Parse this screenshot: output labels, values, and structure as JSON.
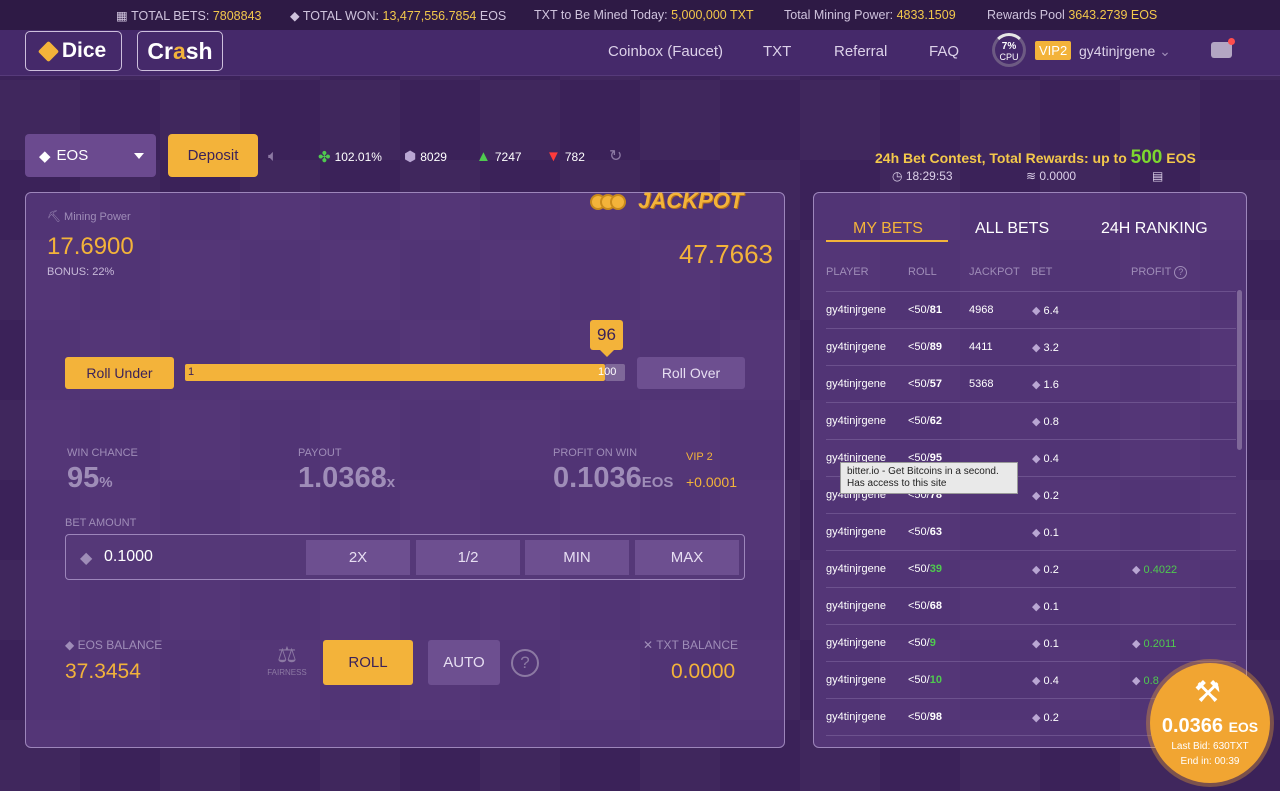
{
  "topbar": {
    "total_bets_label": "TOTAL BETS:",
    "total_bets": "7808843",
    "total_won_label": "TOTAL WON:",
    "total_won": "13,477,556.7854",
    "total_won_unit": "EOS",
    "txt_mined_label": "TXT to Be Mined Today:",
    "txt_mined": "5,000,000 TXT",
    "mining_power_label": "Total Mining Power:",
    "mining_power": "4833.1509",
    "rewards_label": "Rewards Pool",
    "rewards": "3643.2739 EOS"
  },
  "header": {
    "dice": "Dice",
    "crash_pre": "Cr",
    "crash_a": "a",
    "crash_post": "sh",
    "nav": [
      "Coinbox (Faucet)",
      "TXT",
      "Referral",
      "FAQ"
    ],
    "cpu_pct": "7%",
    "cpu_label": "CPU",
    "vip": "VIP2",
    "username": "gy4tinjrgene"
  },
  "controls": {
    "currency": "EOS",
    "deposit": "Deposit",
    "stats": [
      {
        "icon": "clover-icon",
        "value": "102.01%"
      },
      {
        "icon": "cube-icon",
        "value": "8029"
      },
      {
        "icon": "thumbs-up-icon",
        "value": "7247"
      },
      {
        "icon": "thumbs-down-icon",
        "value": "782"
      }
    ]
  },
  "contest": {
    "text": "24h Bet Contest, Total Rewards: up to",
    "amount": "500",
    "unit": "EOS",
    "timer": "18:29:53",
    "value": "0.0000"
  },
  "game": {
    "mining_power_label": "Mining Power",
    "mining_power": "17.6900",
    "bonus": "BONUS: 22%",
    "jackpot_label": "JACKPOT",
    "jackpot_value": "47.7663",
    "roll_under": "Roll Under",
    "roll_over": "Roll Over",
    "slider_min": "1",
    "slider_max": "100",
    "slider_value": "96",
    "win_chance_label": "WIN CHANCE",
    "win_chance": "95",
    "win_chance_unit": "%",
    "payout_label": "PAYOUT",
    "payout": "1.0368",
    "payout_unit": "x",
    "profit_label": "PROFIT ON WIN",
    "profit": "0.1036",
    "profit_unit": "EOS",
    "vip_label": "VIP 2",
    "vip_bonus": "+0.0001",
    "bet_amount_label": "BET AMOUNT",
    "bet_amount": "0.1000",
    "bet_buttons": [
      "2X",
      "1/2",
      "MIN",
      "MAX"
    ],
    "eos_balance_label": "EOS BALANCE",
    "eos_balance": "37.3454",
    "fairness": "FAIRNESS",
    "roll": "ROLL",
    "auto": "AUTO",
    "txt_balance_label": "TXT BALANCE",
    "txt_balance": "0.0000"
  },
  "bets": {
    "tabs": [
      "MY BETS",
      "ALL BETS",
      "24H RANKING"
    ],
    "headers": [
      "PLAYER",
      "ROLL",
      "JACKPOT",
      "BET",
      "PROFIT"
    ],
    "rows": [
      {
        "player": "gy4tinjrgene",
        "roll_pre": "<50/",
        "roll": "81",
        "win": false,
        "jackpot": "4968",
        "bet": "6.4",
        "profit": ""
      },
      {
        "player": "gy4tinjrgene",
        "roll_pre": "<50/",
        "roll": "89",
        "win": false,
        "jackpot": "4411",
        "bet": "3.2",
        "profit": ""
      },
      {
        "player": "gy4tinjrgene",
        "roll_pre": "<50/",
        "roll": "57",
        "win": false,
        "jackpot": "5368",
        "bet": "1.6",
        "profit": ""
      },
      {
        "player": "gy4tinjrgene",
        "roll_pre": "<50/",
        "roll": "62",
        "win": false,
        "jackpot": "",
        "bet": "0.8",
        "profit": ""
      },
      {
        "player": "gy4tinjrgene",
        "roll_pre": "<50/",
        "roll": "95",
        "win": false,
        "jackpot": "",
        "bet": "0.4",
        "profit": ""
      },
      {
        "player": "gy4tinjrgene",
        "roll_pre": "<50/",
        "roll": "78",
        "win": false,
        "jackpot": "",
        "bet": "0.2",
        "profit": ""
      },
      {
        "player": "gy4tinjrgene",
        "roll_pre": "<50/",
        "roll": "63",
        "win": false,
        "jackpot": "",
        "bet": "0.1",
        "profit": ""
      },
      {
        "player": "gy4tinjrgene",
        "roll_pre": "<50/",
        "roll": "39",
        "win": true,
        "jackpot": "",
        "bet": "0.2",
        "profit": "0.4022"
      },
      {
        "player": "gy4tinjrgene",
        "roll_pre": "<50/",
        "roll": "68",
        "win": false,
        "jackpot": "",
        "bet": "0.1",
        "profit": ""
      },
      {
        "player": "gy4tinjrgene",
        "roll_pre": "<50/",
        "roll": "9",
        "win": true,
        "jackpot": "",
        "bet": "0.1",
        "profit": "0.2011"
      },
      {
        "player": "gy4tinjrgene",
        "roll_pre": "<50/",
        "roll": "10",
        "win": true,
        "jackpot": "",
        "bet": "0.4",
        "profit": "0.8"
      },
      {
        "player": "gy4tinjrgene",
        "roll_pre": "<50/",
        "roll": "98",
        "win": false,
        "jackpot": "",
        "bet": "0.2",
        "profit": ""
      }
    ]
  },
  "tooltip": {
    "line1": "bitter.io - Get Bitcoins in a second.",
    "line2": "Has access to this site"
  },
  "auction": {
    "amount": "0.0366",
    "unit": "EOS",
    "last_bid": "Last Bid: 630TXT",
    "end_in": "End in: 00:39"
  }
}
